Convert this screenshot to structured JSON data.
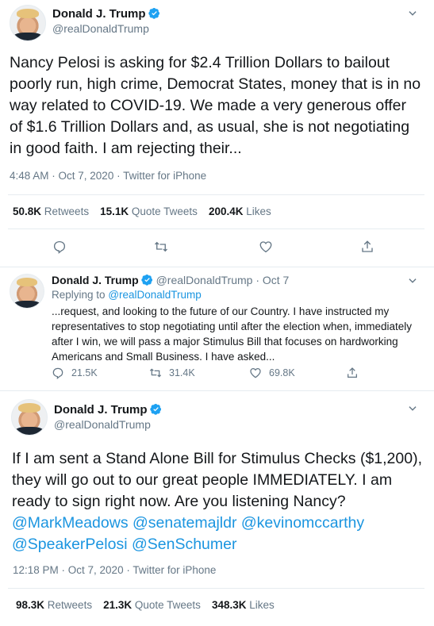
{
  "tweet1": {
    "author_name": "Donald J. Trump",
    "author_handle": "@realDonaldTrump",
    "text": "Nancy Pelosi is asking for $2.4 Trillion Dollars to bailout poorly run, high crime, Democrat States, money that is in no way related to COVID-19. We made a very generous offer of $1.6 Trillion Dollars and, as usual, she is not negotiating in good faith. I am rejecting their...",
    "timestamp": "4:48 AM · Oct 7, 2020 · Twitter for iPhone",
    "retweets_count": "50.8K",
    "retweets_label": "Retweets",
    "quotes_count": "15.1K",
    "quotes_label": "Quote Tweets",
    "likes_count": "200.4K",
    "likes_label": "Likes"
  },
  "tweet2": {
    "author_name": "Donald J. Trump",
    "author_handle": "@realDonaldTrump",
    "date": "· Oct 7",
    "replying_to_label": "Replying to",
    "replying_to_handle": "@realDonaldTrump",
    "text": "...request, and looking to the future of our Country. I have instructed my representatives to stop negotiating until after the election when, immediately after I win, we will pass a major Stimulus Bill that focuses on hardworking Americans and Small Business. I have asked...",
    "reply_count": "21.5K",
    "retweet_count": "31.4K",
    "like_count": "69.8K"
  },
  "tweet3": {
    "author_name": "Donald J. Trump",
    "author_handle": "@realDonaldTrump",
    "text": "If I am sent a Stand Alone Bill for Stimulus Checks ($1,200), they will go out to our great people IMMEDIATELY. I am ready to sign right now. Are you listening Nancy?",
    "mentions": [
      "@MarkMeadows",
      "@senatemajldr",
      "@kevinomccarthy",
      "@SpeakerPelosi",
      "@SenSchumer"
    ],
    "timestamp": "12:18 PM · Oct 7, 2020 · Twitter for iPhone",
    "retweets_count": "98.3K",
    "retweets_label": "Retweets",
    "quotes_count": "21.3K",
    "quotes_label": "Quote Tweets",
    "likes_count": "348.3K",
    "likes_label": "Likes"
  },
  "icons": {
    "verified": "verified-badge-icon",
    "caret": "chevron-down-icon",
    "reply": "reply-icon",
    "retweet": "retweet-icon",
    "like": "heart-icon",
    "share": "share-icon"
  },
  "colors": {
    "accent": "#1b95e0",
    "text": "#14171a",
    "muted": "#657786",
    "divider": "#e6ecf0"
  }
}
